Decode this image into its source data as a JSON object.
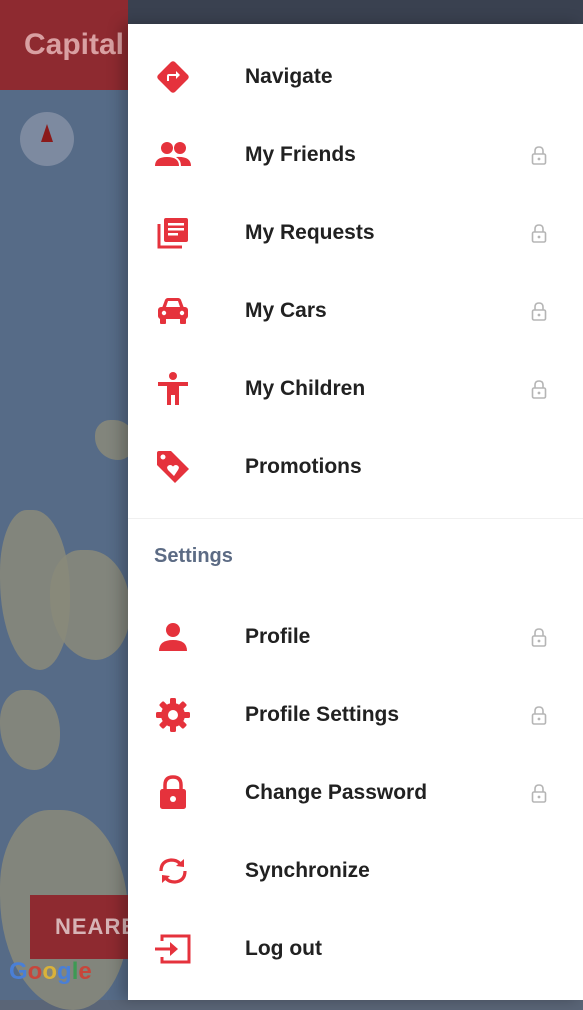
{
  "background": {
    "title": "Capital",
    "nearest_button": "NEARE",
    "google_logo": [
      "G",
      "o",
      "o",
      "g",
      "l",
      "e"
    ]
  },
  "colors": {
    "accent": "#e5323c",
    "lock_gray": "#b5b5b5",
    "section_header": "#5c6b84"
  },
  "drawer": {
    "main_items": [
      {
        "label": "Navigate",
        "icon": "navigate-icon",
        "locked": false
      },
      {
        "label": "My Friends",
        "icon": "friends-icon",
        "locked": true
      },
      {
        "label": "My Requests",
        "icon": "requests-icon",
        "locked": true
      },
      {
        "label": "My Cars",
        "icon": "car-icon",
        "locked": true
      },
      {
        "label": "My Children",
        "icon": "child-icon",
        "locked": true
      },
      {
        "label": "Promotions",
        "icon": "promotion-tag-icon",
        "locked": false
      }
    ],
    "settings_header": "Settings",
    "settings_items": [
      {
        "label": "Profile",
        "icon": "person-icon",
        "locked": true
      },
      {
        "label": "Profile Settings",
        "icon": "gear-icon",
        "locked": true
      },
      {
        "label": "Change Password",
        "icon": "lock-icon",
        "locked": true
      },
      {
        "label": "Synchronize",
        "icon": "sync-icon",
        "locked": false
      },
      {
        "label": "Log out",
        "icon": "logout-icon",
        "locked": false
      }
    ]
  }
}
